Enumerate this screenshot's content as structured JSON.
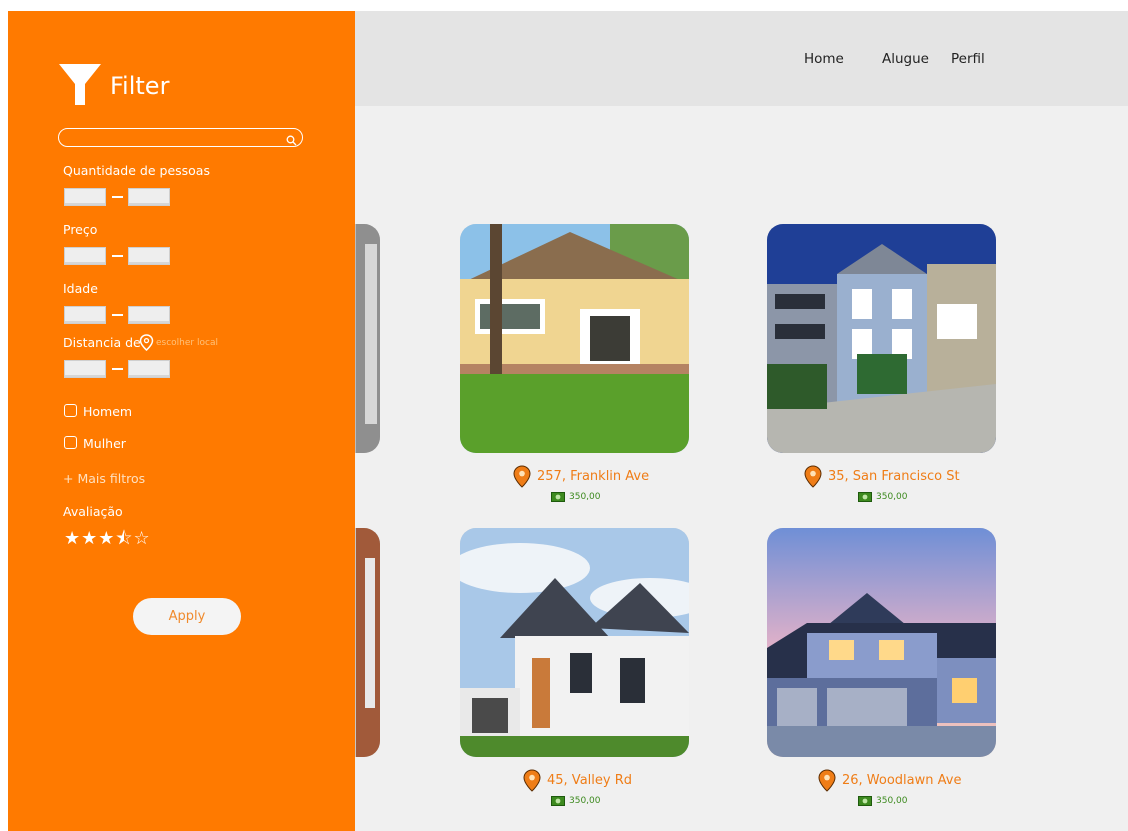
{
  "nav": {
    "home": "Home",
    "rent": "Alugue",
    "profile": "Perfil"
  },
  "filter": {
    "title": "Filter",
    "search": {
      "value": "",
      "placeholder": ""
    },
    "people_label": "Quantidade de pessoas",
    "price_label": "Preço",
    "age_label": "Idade",
    "distance_label": "Distancia de",
    "choose_location": "escolher local",
    "man_label": "Homem",
    "woman_label": "Mulher",
    "more_filters": "+ Mais filtros",
    "rating_label": "Avaliação",
    "rating": {
      "value": 3.5,
      "max": 5,
      "stars": "★★★⯪☆"
    },
    "apply_label": "Apply"
  },
  "listings": [
    {
      "address": "257, Franklin Ave",
      "price": "350,00"
    },
    {
      "address": "35, San Francisco St",
      "price": "350,00"
    },
    {
      "address": "45, Valley Rd",
      "price": "350,00"
    },
    {
      "address": "26, Woodlawn Ave",
      "price": "350,00"
    }
  ],
  "colors": {
    "sidebar": "#ff7a00",
    "accent": "#ef7d17",
    "price": "#3d8a1f",
    "topbar": "#e4e4e4",
    "background": "#f0f0f0"
  }
}
